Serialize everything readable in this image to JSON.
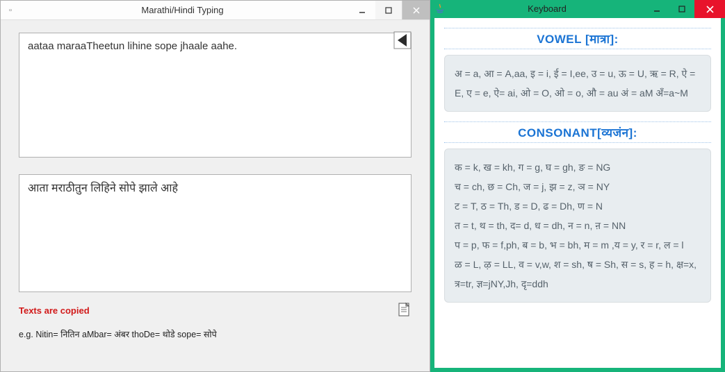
{
  "leftWindow": {
    "title": "Marathi/Hindi Typing",
    "input": "aataa maraaTheetun lihine sope jhaale aahe.",
    "output": "आता मराठीतुन लिहिने सोपे झाले आहे",
    "status": "Texts are copied",
    "example": "e.g. Nitin= नितिन  aMbar= अंबर   thoDe= थोडे   sope= सोपे"
  },
  "rightWindow": {
    "title": "Keyboard",
    "vowel": {
      "heading": "VOWEL [मात्रा]:",
      "body": "अ = a, आ = A,aa, इ = i, ई = I,ee, उ = u, ऊ = U, ऋ = R, ऐ = E, ए = e, ऐ= ai, ओ = O, ओ = o, औ = au अं = aM अँ=a~M"
    },
    "consonant": {
      "heading": "CONSONANT[व्यजंन]:",
      "body": "क = k, ख = kh, ग = g, घ = gh, ङ = NG\nच = ch, छ = Ch, ज = j, झ = z, ञ = NY\nट = T, ठ = Th, ड = D, ढ = Dh, ण = N\nत = t, थ = th, द= d, ध = dh, न = n, ऩ = NN\nप = p, फ = f,ph, ब = b, भ = bh, म = m ,य = y, र = r, ल = l\nळ = L, ऴ = LL, व = v,w, श = sh, ष = Sh, स = s, ह = h, क्ष=x, त्र=tr, ज्ञ=jNY,Jh, दृ=ddh"
    }
  }
}
